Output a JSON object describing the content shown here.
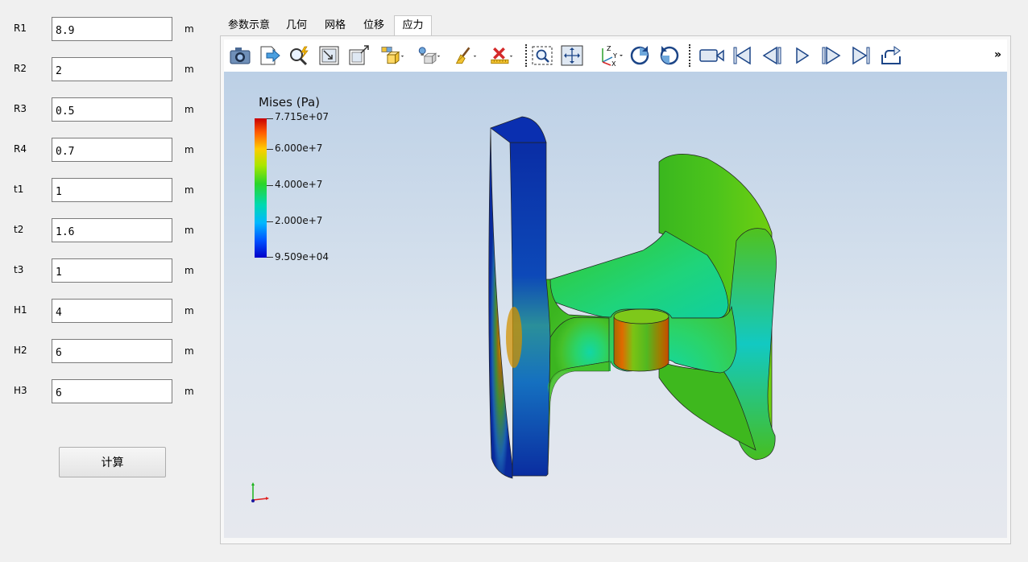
{
  "params": [
    {
      "label": "R1",
      "value": "8.9",
      "unit": "m"
    },
    {
      "label": "R2",
      "value": "2",
      "unit": "m"
    },
    {
      "label": "R3",
      "value": "0.5",
      "unit": "m"
    },
    {
      "label": "R4",
      "value": "0.7",
      "unit": "m"
    },
    {
      "label": "t1",
      "value": "1",
      "unit": "m"
    },
    {
      "label": "t2",
      "value": "1.6",
      "unit": "m"
    },
    {
      "label": "t3",
      "value": "1",
      "unit": "m"
    },
    {
      "label": "H1",
      "value": "4",
      "unit": "m"
    },
    {
      "label": "H2",
      "value": "6",
      "unit": "m"
    },
    {
      "label": "H3",
      "value": "6",
      "unit": "m"
    }
  ],
  "calc_button": "计算",
  "tabs": [
    {
      "label": "参数示意"
    },
    {
      "label": "几何"
    },
    {
      "label": "网格"
    },
    {
      "label": "位移"
    },
    {
      "label": "应力",
      "active": true
    }
  ],
  "toolbar": {
    "more": "»",
    "icons": [
      "camera-icon",
      "export-icon",
      "zoom-magic-icon",
      "reset-camera-icon",
      "zoom-to-box-icon",
      "block-display-icon",
      "light-icon",
      "clear-icon",
      "remove-icon",
      "zoom-selection-icon",
      "fit-view-icon",
      "axes-orientation-icon",
      "rotate-cw-icon",
      "rotate-ccw-icon",
      "record-icon",
      "first-frame-icon",
      "prev-frame-icon",
      "play-icon",
      "next-frame-icon",
      "last-frame-icon",
      "loop-icon"
    ],
    "axes_label_z": "Z",
    "axes_label_y": "Y",
    "axes_label_x": "X"
  },
  "legend": {
    "title": "Mises (Pa)",
    "max": "7.715e+07",
    "t1": "6.000e+7",
    "t2": "4.000e+7",
    "t3": "2.000e+7",
    "min": "9.509e+04"
  },
  "colors": {
    "accent_blue": "#3a7dc9",
    "model_blue": "#0a2fa8",
    "model_green": "#3ec81e"
  }
}
